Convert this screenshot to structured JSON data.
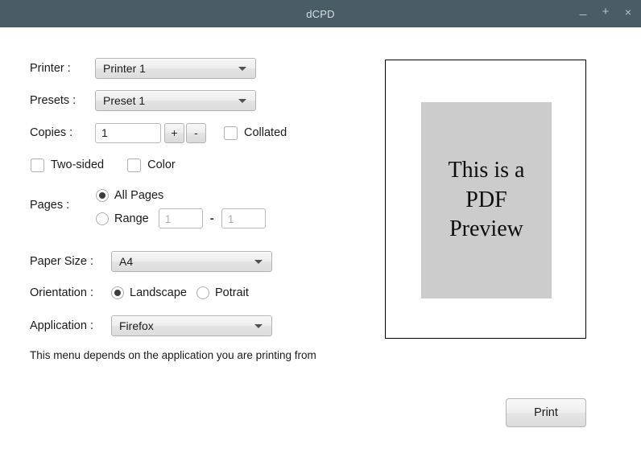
{
  "window": {
    "title": "dCPD",
    "controls": {
      "minimize": "_",
      "maximize": "+",
      "close": "×"
    }
  },
  "form": {
    "printer": {
      "label": "Printer :",
      "value": "Printer 1"
    },
    "presets": {
      "label": "Presets :",
      "value": "Preset 1"
    },
    "copies": {
      "label": "Copies :",
      "value": "1",
      "increment": "+",
      "decrement": "-"
    },
    "collated": {
      "label": "Collated",
      "checked": false
    },
    "two_sided": {
      "label": "Two-sided",
      "checked": false
    },
    "color": {
      "label": "Color",
      "checked": false
    },
    "pages": {
      "label": "Pages :",
      "all_pages_label": "All Pages",
      "range_label": "Range",
      "selected": "all",
      "range_from_placeholder": "1",
      "range_to_placeholder": "1",
      "range_separator": "-"
    },
    "paper_size": {
      "label": "Paper Size :",
      "value": "A4"
    },
    "orientation": {
      "label": "Orientation :",
      "landscape_label": "Landscape",
      "portrait_label": "Potrait",
      "selected": "landscape"
    },
    "application": {
      "label": "Application :",
      "value": "Firefox"
    },
    "hint": "This menu depends on the application you are printing from"
  },
  "preview": {
    "line1": "This is a",
    "line2": "PDF",
    "line3": "Preview"
  },
  "actions": {
    "print_label": "Print"
  },
  "colors": {
    "titlebar": "#4a5c66",
    "titlebar_text": "#d8dfe3",
    "page_background": "#ffffff",
    "preview_page": "#cccccc",
    "preview_border": "#000000",
    "radio_dot": "#3c3c3c"
  }
}
